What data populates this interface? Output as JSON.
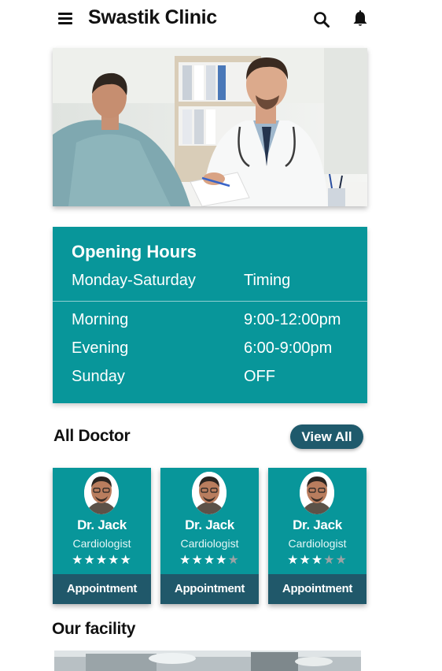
{
  "header": {
    "title": "Swastik Clinic",
    "menu_icon": "hamburger-menu-icon",
    "search_icon": "search-icon",
    "notification_icon": "bell-icon"
  },
  "hero": {
    "image": "doctor-consulting-patient-photo"
  },
  "opening_hours": {
    "title": "Opening Hours",
    "days_header": "Monday-Saturday",
    "timing_header": "Timing",
    "rows": [
      {
        "label": "Morning",
        "value": "9:00-12:00pm"
      },
      {
        "label": "Evening",
        "value": "6:00-9:00pm"
      },
      {
        "label": "Sunday",
        "value": "OFF"
      }
    ]
  },
  "doctors_section": {
    "title": "All Doctor",
    "view_all_label": "View All",
    "doctors": [
      {
        "name": "Dr. Jack",
        "specialty": "Cardiologist",
        "rating": 5,
        "max_rating": 5,
        "button": "Appointment"
      },
      {
        "name": "Dr. Jack",
        "specialty": "Cardiologist",
        "rating": 4,
        "max_rating": 5,
        "button": "Appointment"
      },
      {
        "name": "Dr. Jack",
        "specialty": "Cardiologist",
        "rating": 3,
        "max_rating": 5,
        "button": "Appointment"
      }
    ]
  },
  "facility_section": {
    "title": "Our facility"
  },
  "colors": {
    "primary": "#08969a",
    "secondary": "#20586a",
    "button": "#1f5a6c"
  }
}
